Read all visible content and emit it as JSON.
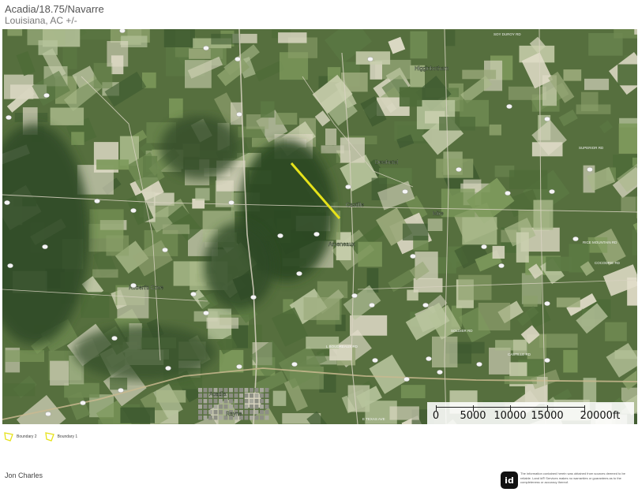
{
  "header": {
    "title": "Acadia/18.75/Navarre",
    "subtitle": "Louisiana,  AC +/-"
  },
  "map": {
    "place_labels": [
      "Higginbotham",
      "Dewhetel",
      "Castille",
      "Mire",
      "Arceneaux",
      "Robert's Cove",
      "Rayne",
      "Acadia"
    ],
    "road_labels": [
      "SOY DUROY RD",
      "SUPERIOR RD",
      "L BOUDREAUX RD",
      "CASTILLE RD",
      "RICE MOUNTAIN RD",
      "COCODRIE RD",
      "E TEXAS AVE",
      "SOLDIER RD"
    ],
    "boundary_color": "#e6e21a",
    "scale": {
      "labels": [
        "0",
        "5000",
        "10000",
        "15000",
        "20000ft"
      ],
      "values_ft": [
        0,
        5000,
        10000,
        15000,
        20000
      ]
    }
  },
  "legend": {
    "items": [
      {
        "label": "Boundary 2",
        "color": "#e6e21a"
      },
      {
        "label": "Boundary 1",
        "color": "#e6e21a"
      }
    ]
  },
  "footer": {
    "author": "Jon Charles",
    "logo_text": "id",
    "disclaimer": "The information contained herein was obtained from sources deemed to be reliable. Land id® Services makes no warranties or guarantees as to the completeness or accuracy thereof."
  }
}
